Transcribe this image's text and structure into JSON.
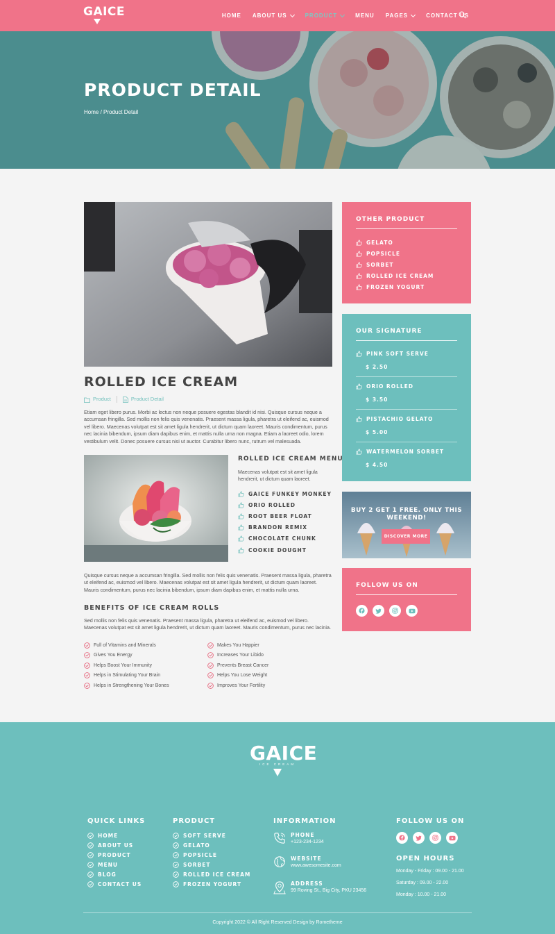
{
  "brand": {
    "name": "GAICE",
    "tagline": "ICE CREAM"
  },
  "nav": {
    "items": [
      {
        "label": "HOME"
      },
      {
        "label": "ABOUT US"
      },
      {
        "label": "PRODUCT"
      },
      {
        "label": "MENU"
      },
      {
        "label": "PAGES"
      },
      {
        "label": "CONTACT US"
      }
    ],
    "active": "PRODUCT"
  },
  "hero": {
    "title": "PRODUCT DETAIL",
    "breadcrumb_home": "Home",
    "breadcrumb_sep": " / ",
    "breadcrumb_current": "Product Detail"
  },
  "product": {
    "title": "ROLLED ICE CREAM",
    "category": "Product",
    "tag": "Product Detail",
    "description": "Etiam eget libero purus. Morbi ac lectus non neque posuere egestas blandit id nisi. Quisque cursus neque a accumsan fringilla. Sed mollis non felis quis venenatis. Praesent massa ligula, pharetra ut eleifend ac, euismod vel libero. Maecenas volutpat est sit amet ligula hendrerit, ut dictum quam laoreet. Mauris condimentum, purus nec lacinia bibendum, ipsum diam dapibus enim, et mattis nulla urna non magna. Etiam a laoreet odio, lorem vestibulum velit. Donec posuere cursus nisi ut auctor. Curabitur libero nunc, rutrum vel malesuada.",
    "menu_title": "ROLLED ICE CREAM MENU",
    "menu_sub": "Maecenas volutpat est sit amet ligula hendrerit, ut dictum quam laoreet.",
    "flavors": [
      "GAICE FUNKEY MONKEY",
      "ORIO ROLLED",
      "ROOT BEER FLOAT",
      "BRANDON REMIX",
      "CHOCOLATE CHUNK",
      "COOKIE DOUGHT"
    ],
    "paragraph2": "Quisque cursus neque a accumsan fringilla. Sed mollis non felis quis venenatis. Praesent massa ligula, pharetra ut eleifend ac, euismod vel libero. Maecenas volutpat est sit amet ligula hendrerit, ut dictum quam laoreet. Mauris condimentum, purus nec lacinia bibendum, ipsum diam dapibus enim, et mattis nulla urna.",
    "benefits_title": "BENEFITS OF ICE CREAM ROLLS",
    "benefits_text": "Sed mollis non felis quis venenatis. Praesent massa ligula, pharetra ut eleifend ac, euismod vel libero. Maecenas volutpat est sit amet ligula hendrerit, ut dictum quam laoreet. Mauris condimentum, purus nec lacinia.",
    "benefits": [
      "Full of Vitamins and Minerals",
      "Makes You Happier",
      "Gives You Energy",
      "Increases Your Libido",
      "Helps Boost Your Immunity",
      "Prevents Breast Cancer",
      "Helps in Stimulating Your Brain",
      "Helps You Lose Weight",
      "Helps in Strengthening Your Bones",
      "Improves Your Fertility"
    ]
  },
  "sidebar": {
    "other_title": "OTHER PRODUCT",
    "other_items": [
      "GELATO",
      "POPSICLE",
      "SORBET",
      "ROLLED ICE CREAM",
      "FROZEN YOGURT"
    ],
    "signature_title": "OUR SIGNATURE",
    "signature": [
      {
        "name": "PINK SOFT SERVE",
        "price": "$ 2.50"
      },
      {
        "name": "ORIO ROLLED",
        "price": "$ 3.50"
      },
      {
        "name": "PISTACHIO GELATO",
        "price": "$ 5.00"
      },
      {
        "name": "WATERMELON SORBET",
        "price": "$ 4.50"
      }
    ],
    "promo_text": "BUY 2 GET 1 FREE. ONLY THIS WEEKEND!",
    "promo_button": "DISCOVER MORE",
    "follow_title": "FOLLOW US ON"
  },
  "footer": {
    "quick_title": "QUICK LINKS",
    "quick_links": [
      "HOME",
      "ABOUT US",
      "PRODUCT",
      "MENU",
      "BLOG",
      "CONTACT US"
    ],
    "product_title": "PRODUCT",
    "product_links": [
      "SOFT SERVE",
      "GELATO",
      "POPSICLE",
      "SORBET",
      "ROLLED ICE CREAM",
      "FROZEN YOGURT"
    ],
    "info_title": "INFORMATION",
    "phone_label": "PHONE",
    "phone": "+123-234-1234",
    "website_label": "WEBSITE",
    "website": "www.awesomesite.com",
    "address_label": "ADDRESS",
    "address": "99 Roving St., Big City, PKU 23456",
    "follow_title": "FOLLOW US ON",
    "hours_title": "OPEN HOURS",
    "hours": [
      "Monday - Friday : 09.00 - 21.00",
      "Saturday : 09.00 - 22.00",
      "Monday : 10.00 - 21.00"
    ],
    "copyright": "Copyright 2022 © All Right Reserved Design by Rometheme"
  },
  "colors": {
    "pink": "#f07389",
    "teal": "#6dbfbd",
    "text": "#555555"
  }
}
